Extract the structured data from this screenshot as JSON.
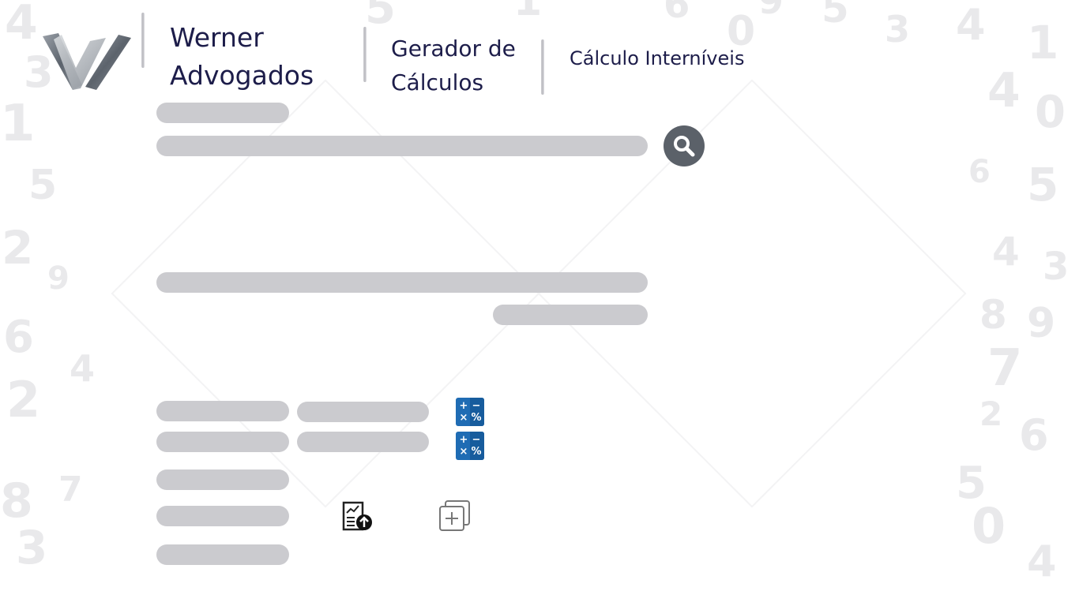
{
  "header": {
    "logo": "werner-advogados-logo",
    "brand_line1": "Werner",
    "brand_line2": "Advogados",
    "module_line1": "Gerador de",
    "module_line2": "Cálculos",
    "subtitle": "Cálculo Interníveis"
  },
  "actions": {
    "search_icon": "search-icon",
    "calculator_icon": "calculator-icon",
    "upload_report_icon": "report-upload-icon",
    "add_copy_icon": "add-copy-icon"
  },
  "calculator_symbols": [
    "+",
    "−",
    "×",
    "%"
  ],
  "colors": {
    "brand_text": "#1d1d4a",
    "skeleton": "#cbcbcf",
    "search_button": "#5b6169",
    "calculator_blue": "#1f6cb4",
    "background_numbers": "#e9e9eb"
  },
  "background_numbers": [
    "4",
    "3",
    "1",
    "5",
    "2",
    "9",
    "6",
    "4",
    "2",
    "7",
    "8",
    "3",
    "5",
    "0",
    "1",
    "6",
    "9",
    "5",
    "3",
    "4",
    "1",
    "4",
    "0",
    "6",
    "5",
    "4",
    "3",
    "8",
    "9",
    "7",
    "2",
    "6",
    "5",
    "0",
    "4"
  ]
}
